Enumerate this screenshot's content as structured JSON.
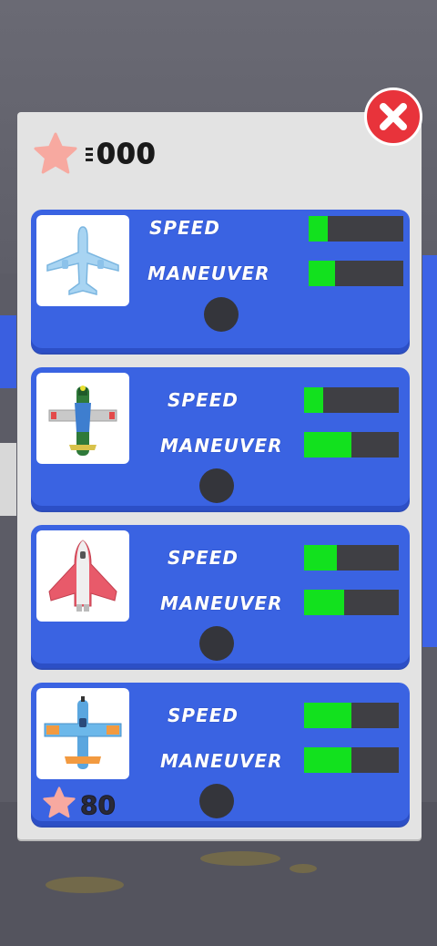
{
  "currency": {
    "icon": "star-icon",
    "value": "000"
  },
  "close": {
    "icon": "close-icon"
  },
  "planes": [
    {
      "icon": "airliner-icon",
      "speed_label": "SPEED",
      "maneuver_label": "MANEUVER",
      "speed_level": 0.2,
      "maneuver_level": 0.28
    },
    {
      "icon": "propeller-fighter-icon",
      "speed_label": "SPEED",
      "maneuver_label": "MANEUVER",
      "speed_level": 0.2,
      "maneuver_level": 0.5
    },
    {
      "icon": "shuttle-jet-icon",
      "speed_label": "SPEED",
      "maneuver_label": "MANEUVER",
      "speed_level": 0.35,
      "maneuver_level": 0.42
    },
    {
      "icon": "blue-propeller-plane-icon",
      "speed_label": "SPEED",
      "maneuver_label": "MANEUVER",
      "speed_level": 0.5,
      "maneuver_level": 0.5,
      "price": "80",
      "price_icon": "star-icon"
    }
  ],
  "colors": {
    "card": "#3a63e2",
    "bar_fill": "#12e11e",
    "bar_empty": "#3f3f44",
    "close": "#e8333b",
    "star": "#f7a9a0"
  }
}
